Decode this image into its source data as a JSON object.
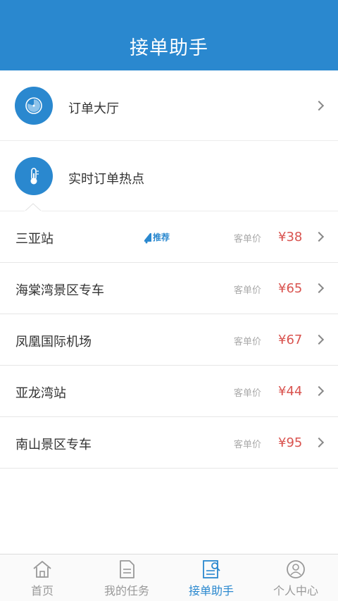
{
  "header": {
    "title": "接单助手"
  },
  "features": [
    {
      "label": "订单大厅",
      "icon": "clock-icon"
    },
    {
      "label": "实时订单热点",
      "icon": "thermometer-icon"
    }
  ],
  "orders": [
    {
      "name": "三亚站",
      "badge": "推荐",
      "price_label": "客单价",
      "price": "¥38"
    },
    {
      "name": "海棠湾景区专车",
      "price_label": "客单价",
      "price": "¥65"
    },
    {
      "name": "凤凰国际机场",
      "price_label": "客单价",
      "price": "¥67"
    },
    {
      "name": "亚龙湾站",
      "price_label": "客单价",
      "price": "¥44"
    },
    {
      "name": "南山景区专车",
      "price_label": "客单价",
      "price": "¥95"
    }
  ],
  "tabs": [
    {
      "label": "首页",
      "icon": "home-icon"
    },
    {
      "label": "我的任务",
      "icon": "document-icon"
    },
    {
      "label": "接单助手",
      "icon": "search-document-icon",
      "active": true
    },
    {
      "label": "个人中心",
      "icon": "user-icon"
    }
  ],
  "colors": {
    "primary": "#2a88cf",
    "price": "#d9534f"
  }
}
